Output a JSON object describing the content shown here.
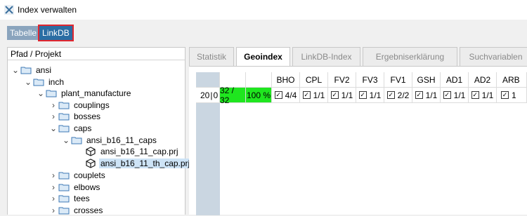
{
  "window": {
    "title": "Index verwalten"
  },
  "toggle": {
    "left_label": "Tabelle",
    "right_label": "LinkDB"
  },
  "tree": {
    "header": "Pfad / Projekt",
    "items": [
      {
        "label": "ansi",
        "type": "folder",
        "expanded": true
      },
      {
        "label": "inch",
        "type": "folder",
        "expanded": true
      },
      {
        "label": "plant_manufacture",
        "type": "folder",
        "expanded": true
      },
      {
        "label": "couplings",
        "type": "folder",
        "expanded": false
      },
      {
        "label": "bosses",
        "type": "folder",
        "expanded": false
      },
      {
        "label": "caps",
        "type": "folder",
        "expanded": true
      },
      {
        "label": "ansi_b16_11_caps",
        "type": "folder",
        "expanded": true
      },
      {
        "label": "ansi_b16_11_cap.prj",
        "type": "project"
      },
      {
        "label": "ansi_b16_11_th_cap.prj",
        "type": "project",
        "selected": true
      },
      {
        "label": "couplets",
        "type": "folder",
        "expanded": false
      },
      {
        "label": "elbows",
        "type": "folder",
        "expanded": false
      },
      {
        "label": "tees",
        "type": "folder",
        "expanded": false
      },
      {
        "label": "crosses",
        "type": "folder",
        "expanded": false
      }
    ]
  },
  "tabs": [
    {
      "label": "Statistik",
      "active": false
    },
    {
      "label": "Geoindex",
      "active": true
    },
    {
      "label": "LinkDB-Index",
      "active": false
    },
    {
      "label": "Ergebniserklärung",
      "active": false
    },
    {
      "label": "Suchvariablen",
      "active": false
    }
  ],
  "grid": {
    "columns": [
      "",
      "",
      "",
      "BHO",
      "CPL",
      "FV2",
      "FV3",
      "FV1",
      "GSH",
      "AD1",
      "AD2",
      "ARB"
    ],
    "row": {
      "id": "20",
      "id2": "0",
      "ratio": "32 / 32",
      "percent": "100 %",
      "cells": [
        "4/4",
        "1/1",
        "1/1",
        "1/1",
        "2/2",
        "1/1",
        "1/1",
        "1/1",
        "1"
      ]
    }
  },
  "colors": {
    "accent": "#2b6da3",
    "highlight_green": "#1fe61f",
    "selection": "#cde3f6",
    "toggle_outline": "#e0262f"
  }
}
